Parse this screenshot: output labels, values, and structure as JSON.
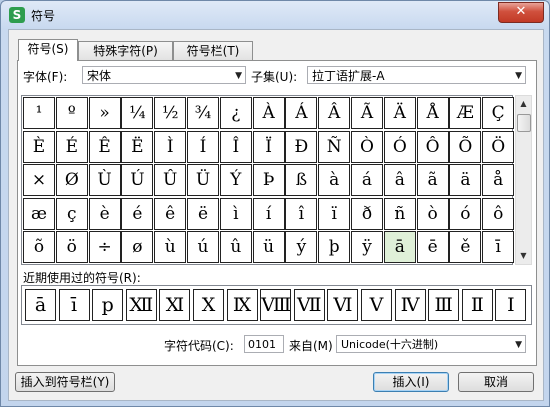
{
  "window": {
    "title": "符号",
    "app_icon_text": "S",
    "close_glyph": "✕"
  },
  "tabs": [
    {
      "label": "符号(S)",
      "active": true
    },
    {
      "label": "特殊字符(P)",
      "active": false
    },
    {
      "label": "符号栏(T)",
      "active": false
    }
  ],
  "font": {
    "label": "字体(F):",
    "value": "宋体"
  },
  "subset": {
    "label": "子集(U):",
    "value": "拉丁语扩展-A"
  },
  "symbols": [
    [
      "¹",
      "º",
      "»",
      "¼",
      "½",
      "¾",
      "¿",
      "À",
      "Á",
      "Â",
      "Ã",
      "Ä",
      "Å",
      "Æ",
      "Ç"
    ],
    [
      "È",
      "É",
      "Ê",
      "Ë",
      "Ì",
      "Í",
      "Î",
      "Ï",
      "Ð",
      "Ñ",
      "Ò",
      "Ó",
      "Ô",
      "Õ",
      "Ö"
    ],
    [
      "×",
      "Ø",
      "Ù",
      "Ú",
      "Û",
      "Ü",
      "Ý",
      "Þ",
      "ß",
      "à",
      "á",
      "â",
      "ã",
      "ä",
      "å"
    ],
    [
      "æ",
      "ç",
      "è",
      "é",
      "ê",
      "ë",
      "ì",
      "í",
      "î",
      "ï",
      "ð",
      "ñ",
      "ò",
      "ó",
      "ô"
    ],
    [
      "õ",
      "ö",
      "÷",
      "ø",
      "ù",
      "ú",
      "û",
      "ü",
      "ý",
      "þ",
      "ÿ",
      "ā",
      "ē",
      "ě",
      "ī"
    ]
  ],
  "selected_symbol": "ā",
  "recent": {
    "label": "近期使用过的符号(R):",
    "symbols": [
      "ā",
      "ī",
      "p",
      "Ⅻ",
      "Ⅺ",
      "Ⅹ",
      "Ⅸ",
      "Ⅷ",
      "Ⅶ",
      "Ⅵ",
      "Ⅴ",
      "Ⅳ",
      "Ⅲ",
      "Ⅱ",
      "Ⅰ"
    ]
  },
  "char_code": {
    "label": "字符代码(C):",
    "value": "0101"
  },
  "from": {
    "label": "来自(M)",
    "value": "Unicode(十六进制)"
  },
  "buttons": {
    "insert_to_bar": "插入到符号栏(Y)",
    "insert": "插入(I)",
    "cancel": "取消"
  }
}
